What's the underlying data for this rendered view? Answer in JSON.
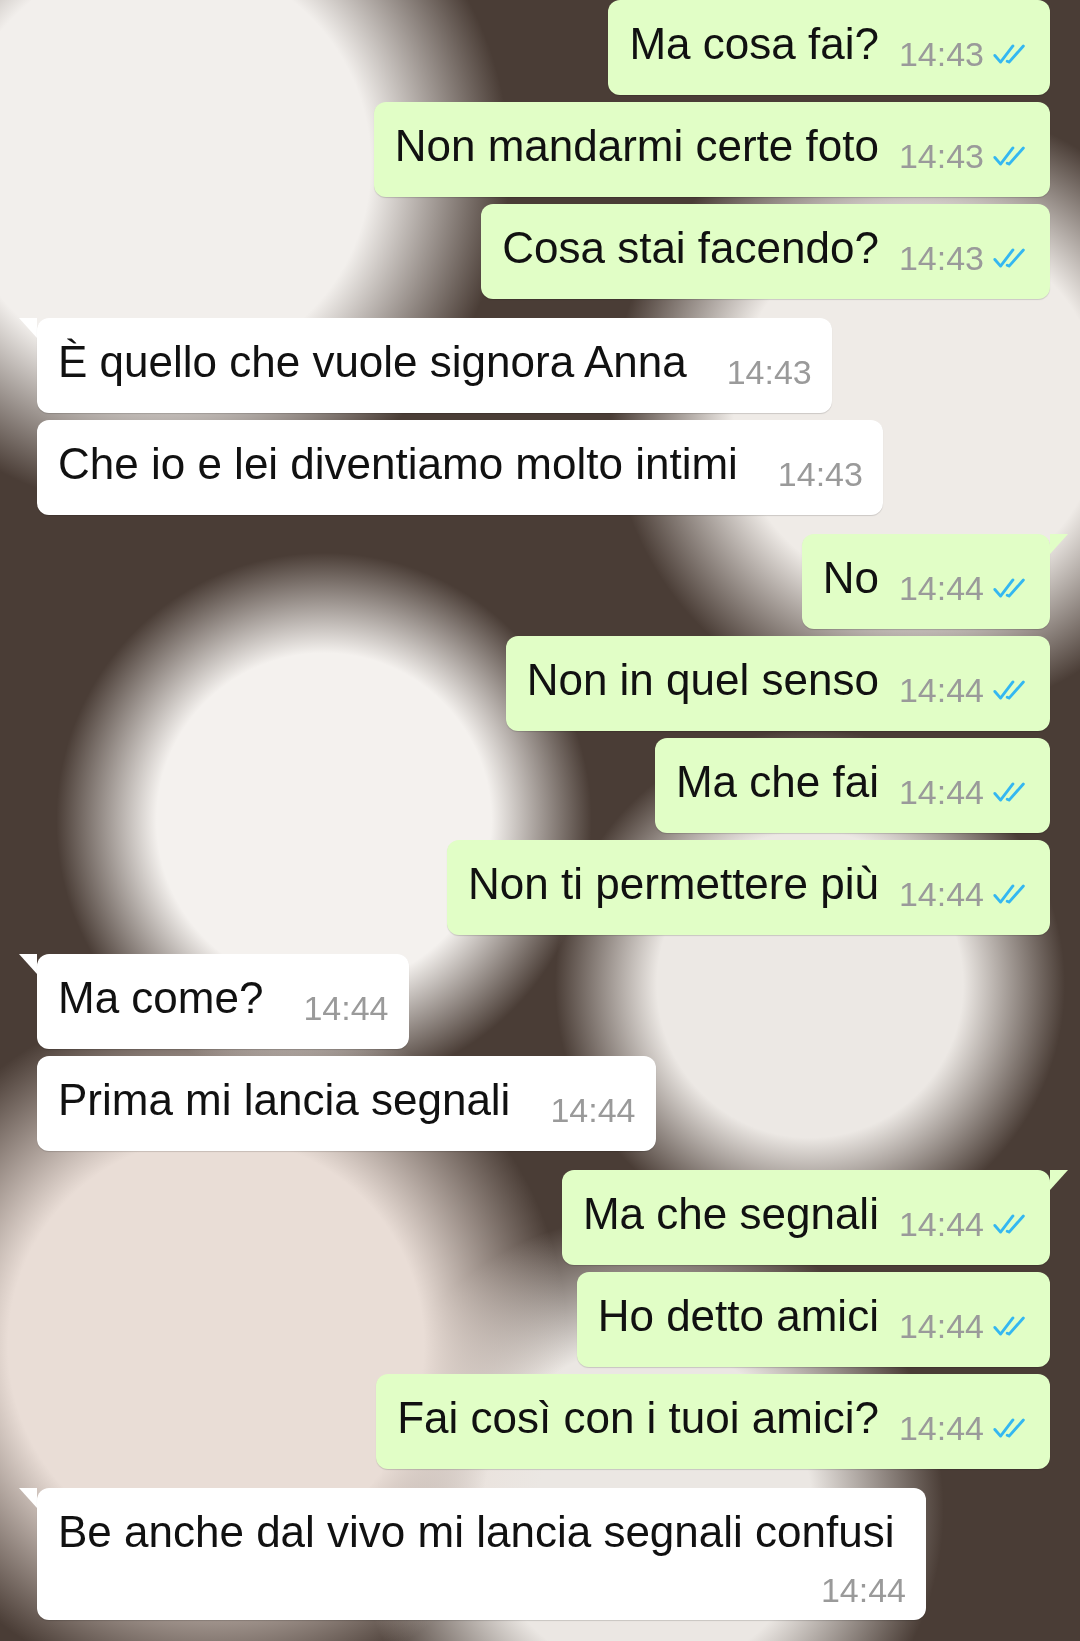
{
  "messages": [
    {
      "kind": "sent",
      "text": "Ma cosa fai?",
      "time": "14:43",
      "read": true,
      "tail": false
    },
    {
      "kind": "sent",
      "text": "Non mandarmi certe foto",
      "time": "14:43",
      "read": true,
      "tail": false
    },
    {
      "kind": "sent",
      "text": "Cosa stai facendo?",
      "time": "14:43",
      "read": true,
      "tail": false
    },
    {
      "kind": "received",
      "text": "È quello che vuole signora Anna",
      "time": "14:43",
      "tail": true
    },
    {
      "kind": "received",
      "text": "Che io e lei diventiamo molto intimi",
      "time": "14:43",
      "tail": false
    },
    {
      "kind": "sent",
      "text": "No",
      "time": "14:44",
      "read": true,
      "tail": true
    },
    {
      "kind": "sent",
      "text": "Non in quel senso",
      "time": "14:44",
      "read": true,
      "tail": false
    },
    {
      "kind": "sent",
      "text": "Ma che fai",
      "time": "14:44",
      "read": true,
      "tail": false
    },
    {
      "kind": "sent",
      "text": "Non ti permettere più",
      "time": "14:44",
      "read": true,
      "tail": false
    },
    {
      "kind": "received",
      "text": "Ma come?",
      "time": "14:44",
      "tail": true
    },
    {
      "kind": "received",
      "text": "Prima mi lancia segnali",
      "time": "14:44",
      "tail": false
    },
    {
      "kind": "sent",
      "text": "Ma che segnali",
      "time": "14:44",
      "read": true,
      "tail": true
    },
    {
      "kind": "sent",
      "text": "Ho detto amici",
      "time": "14:44",
      "read": true,
      "tail": false
    },
    {
      "kind": "sent",
      "text": "Fai così con i tuoi amici?",
      "time": "14:44",
      "read": true,
      "tail": false
    },
    {
      "kind": "received",
      "text": "Be anche dal vivo mi lancia segnali confusi",
      "time": "14:44",
      "tail": true
    }
  ]
}
